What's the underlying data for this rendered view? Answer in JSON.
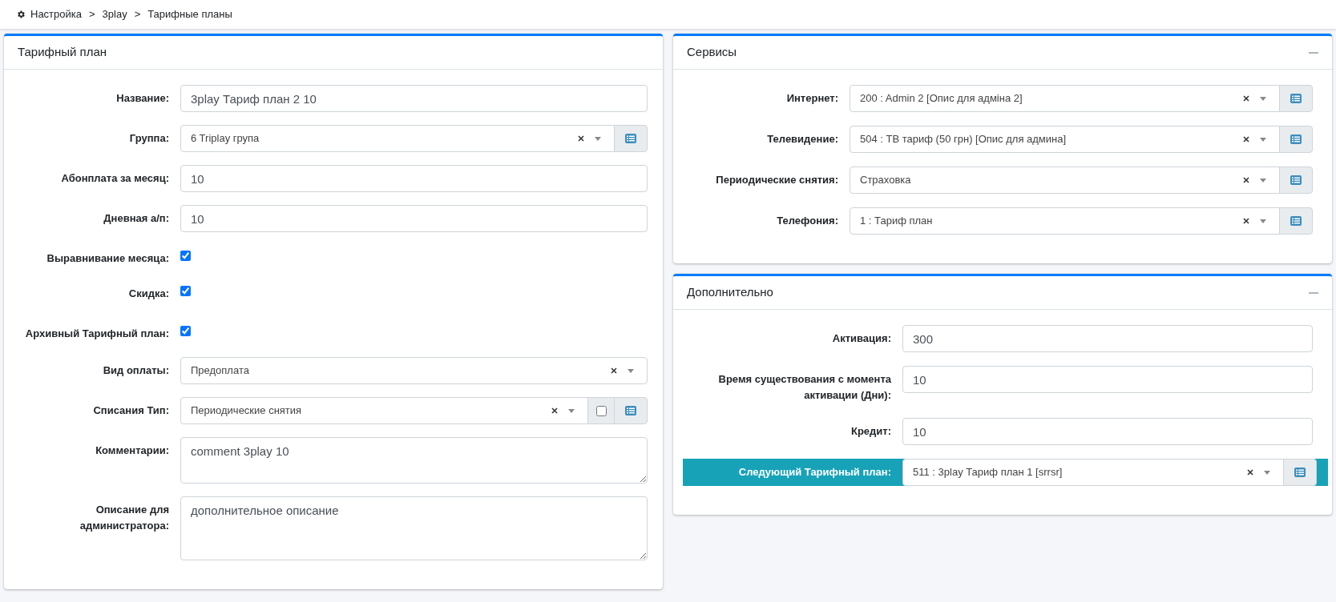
{
  "breadcrumb": {
    "separator": ">",
    "items": [
      "Настройка",
      "3play",
      "Тарифные планы"
    ]
  },
  "panels": [
    {
      "title": "Тарифный план",
      "collapsible": false,
      "fields": [
        {
          "kind": "text",
          "label": "Название:",
          "value": "3play Тариф план 2 10"
        },
        {
          "kind": "select",
          "label": "Группа:",
          "value": "6 Triplay група",
          "list_button": true
        },
        {
          "kind": "text",
          "label": "Абонплата за месяц:",
          "value": "10"
        },
        {
          "kind": "text",
          "label": "Дневная а/п:",
          "value": "10"
        },
        {
          "kind": "checkbox",
          "label": "Выравнивание месяца:",
          "checked": true
        },
        {
          "kind": "checkbox",
          "label": "Скидка:",
          "checked": true
        },
        {
          "kind": "checkbox",
          "label": "Архивный Тарифный план:",
          "checked": true
        },
        {
          "kind": "select",
          "label": "Вид оплаты:",
          "value": "Предоплата",
          "list_button": false
        },
        {
          "kind": "select",
          "label": "Списания Тип:",
          "value": "Периодические снятия",
          "list_button": true,
          "toggle": {
            "checked": false
          }
        },
        {
          "kind": "textarea",
          "label": "Комментарии:",
          "value": "comment 3play 10"
        },
        {
          "kind": "textarea",
          "label": "Описание для администратора:",
          "value": "дополнительное описание"
        }
      ]
    },
    {
      "title": "Сервисы",
      "collapsible": true,
      "fields": [
        {
          "kind": "select",
          "label": "Интернет:",
          "value": "200 : Admin 2 [Опис для адміна 2]",
          "list_button": true
        },
        {
          "kind": "select",
          "label": "Телевидение:",
          "value": "504 : ТВ тариф (50 грн) [Опис для админа]",
          "list_button": true
        },
        {
          "kind": "select",
          "label": "Периодические снятия:",
          "value": "Страховка",
          "list_button": true
        },
        {
          "kind": "select",
          "label": "Телефония:",
          "value": "1 : Тариф план",
          "list_button": true
        }
      ]
    },
    {
      "title": "Дополнительно",
      "collapsible": true,
      "fields": [
        {
          "kind": "text",
          "label": "Активация:",
          "value": "300",
          "highlighted": false
        },
        {
          "kind": "text",
          "label": "Время существования с момента активации (Дни):",
          "value": "10",
          "highlighted": false
        },
        {
          "kind": "text",
          "label": "Кредит:",
          "value": "10",
          "highlighted": false
        },
        {
          "kind": "select",
          "label": "Следующий Тарифный план:",
          "value": "511 : 3play Тариф план 1 [srrsr]",
          "list_button": true,
          "highlighted": true
        }
      ]
    }
  ]
}
